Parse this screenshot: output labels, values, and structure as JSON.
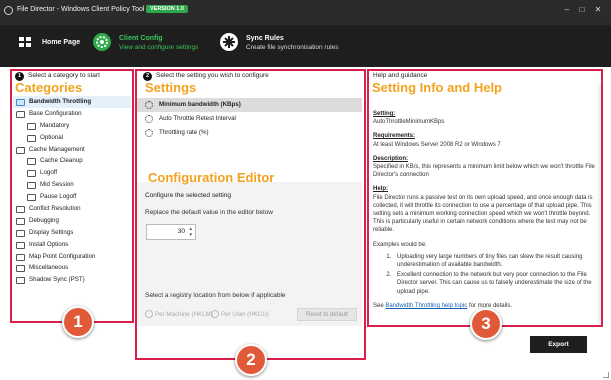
{
  "window": {
    "title": "File Director - Windows Client Policy Tool",
    "version_badge": "VERSION 1.0",
    "minimize": "–",
    "maximize": "□",
    "close": "✕"
  },
  "nav": [
    {
      "icon": "home-icon",
      "title": "Home Page",
      "subtitle": ""
    },
    {
      "icon": "gear-icon",
      "title": "Client Config",
      "subtitle": "View and configure settings"
    },
    {
      "icon": "sync-icon",
      "title": "Sync Rules",
      "subtitle": "Create file synchronisation rules"
    }
  ],
  "categories_panel": {
    "step": "1",
    "heading": "Select a category to start",
    "overlay_title": "Categories",
    "items": [
      {
        "label": "Bandwidth Throttling",
        "level": 0,
        "selected": true
      },
      {
        "label": "Base Configuration",
        "level": 0,
        "open": true
      },
      {
        "label": "Mandatory",
        "level": 1
      },
      {
        "label": "Optional",
        "level": 1
      },
      {
        "label": "Cache Management",
        "level": 0,
        "open": true
      },
      {
        "label": "Cache Cleanup",
        "level": 1
      },
      {
        "label": "Logoff",
        "level": 1
      },
      {
        "label": "Mid Session",
        "level": 1
      },
      {
        "label": "Pause Logoff",
        "level": 1
      },
      {
        "label": "Conflict Resolution",
        "level": 0
      },
      {
        "label": "Debugging",
        "level": 0
      },
      {
        "label": "Display Settings",
        "level": 0
      },
      {
        "label": "Install Options",
        "level": 0
      },
      {
        "label": "Map Point Configuration",
        "level": 0
      },
      {
        "label": "Miscellaneous",
        "level": 0
      },
      {
        "label": "Shadow Sync (PST)",
        "level": 0
      }
    ]
  },
  "settings_panel": {
    "step": "2",
    "heading": "Select the setting you wish to configure",
    "overlay_title": "Settings",
    "items": [
      {
        "label": "Minimum bandwidth (KBps)",
        "selected": true
      },
      {
        "label": "Auto Throttle Retest Interval"
      },
      {
        "label": "Throttling rate (%)"
      }
    ],
    "editor_overlay_title": "Configuration Editor",
    "configure_heading": "Configure the selected setting",
    "replace_text": "Replace the default value in the editor below",
    "value": "30",
    "registry_text": "Select a registry location from below if applicable",
    "radio_machine": "Per Machine (HKLM)",
    "radio_user": "Per User (HKCU)",
    "reset_label": "Reset to default"
  },
  "help_panel": {
    "heading": "Help and guidance",
    "overlay_title": "Setting Info and Help",
    "setting_label": "Setting:",
    "setting_value": "AutoThrottleMinimumKBps",
    "requirements_label": "Requirements:",
    "requirements_value": "At least Windows Server 2008 R2 or Windows 7",
    "description_label": "Description:",
    "description_value": "Specified in KB/s, this represents a minimum limit below which we won't throttle File Director's connection",
    "help_label": "Help:",
    "help_value": "File Director runs a passive test on its own upload speed, and once enough data is collected, it will throttle its connection to use a percentage of that upload pipe. This setting sets a minimum working connection speed which we won't throttle beyond. This is particularly useful in certain network conditions where the test may not be reliable.",
    "examples_intro": "Examples would be:",
    "examples": [
      "Uploading very large numbers of tiny files can skew the result causing underestimation of available bandwidth.",
      "Excellent connection to the network but very poor connection to the File Director server. This can cause us to falsely underestimate the size of the upload pipe."
    ],
    "see_prefix": "See ",
    "see_link": "Bandwidth Throttling help topic",
    "see_suffix": " for more details."
  },
  "export_label": "Export",
  "callouts": [
    "1",
    "2",
    "3"
  ],
  "colors": {
    "accent_green": "#2ea84a",
    "overlay_orange": "#f2a21e",
    "highlight_red": "#d9204a",
    "callout_red": "#e05a3a"
  }
}
